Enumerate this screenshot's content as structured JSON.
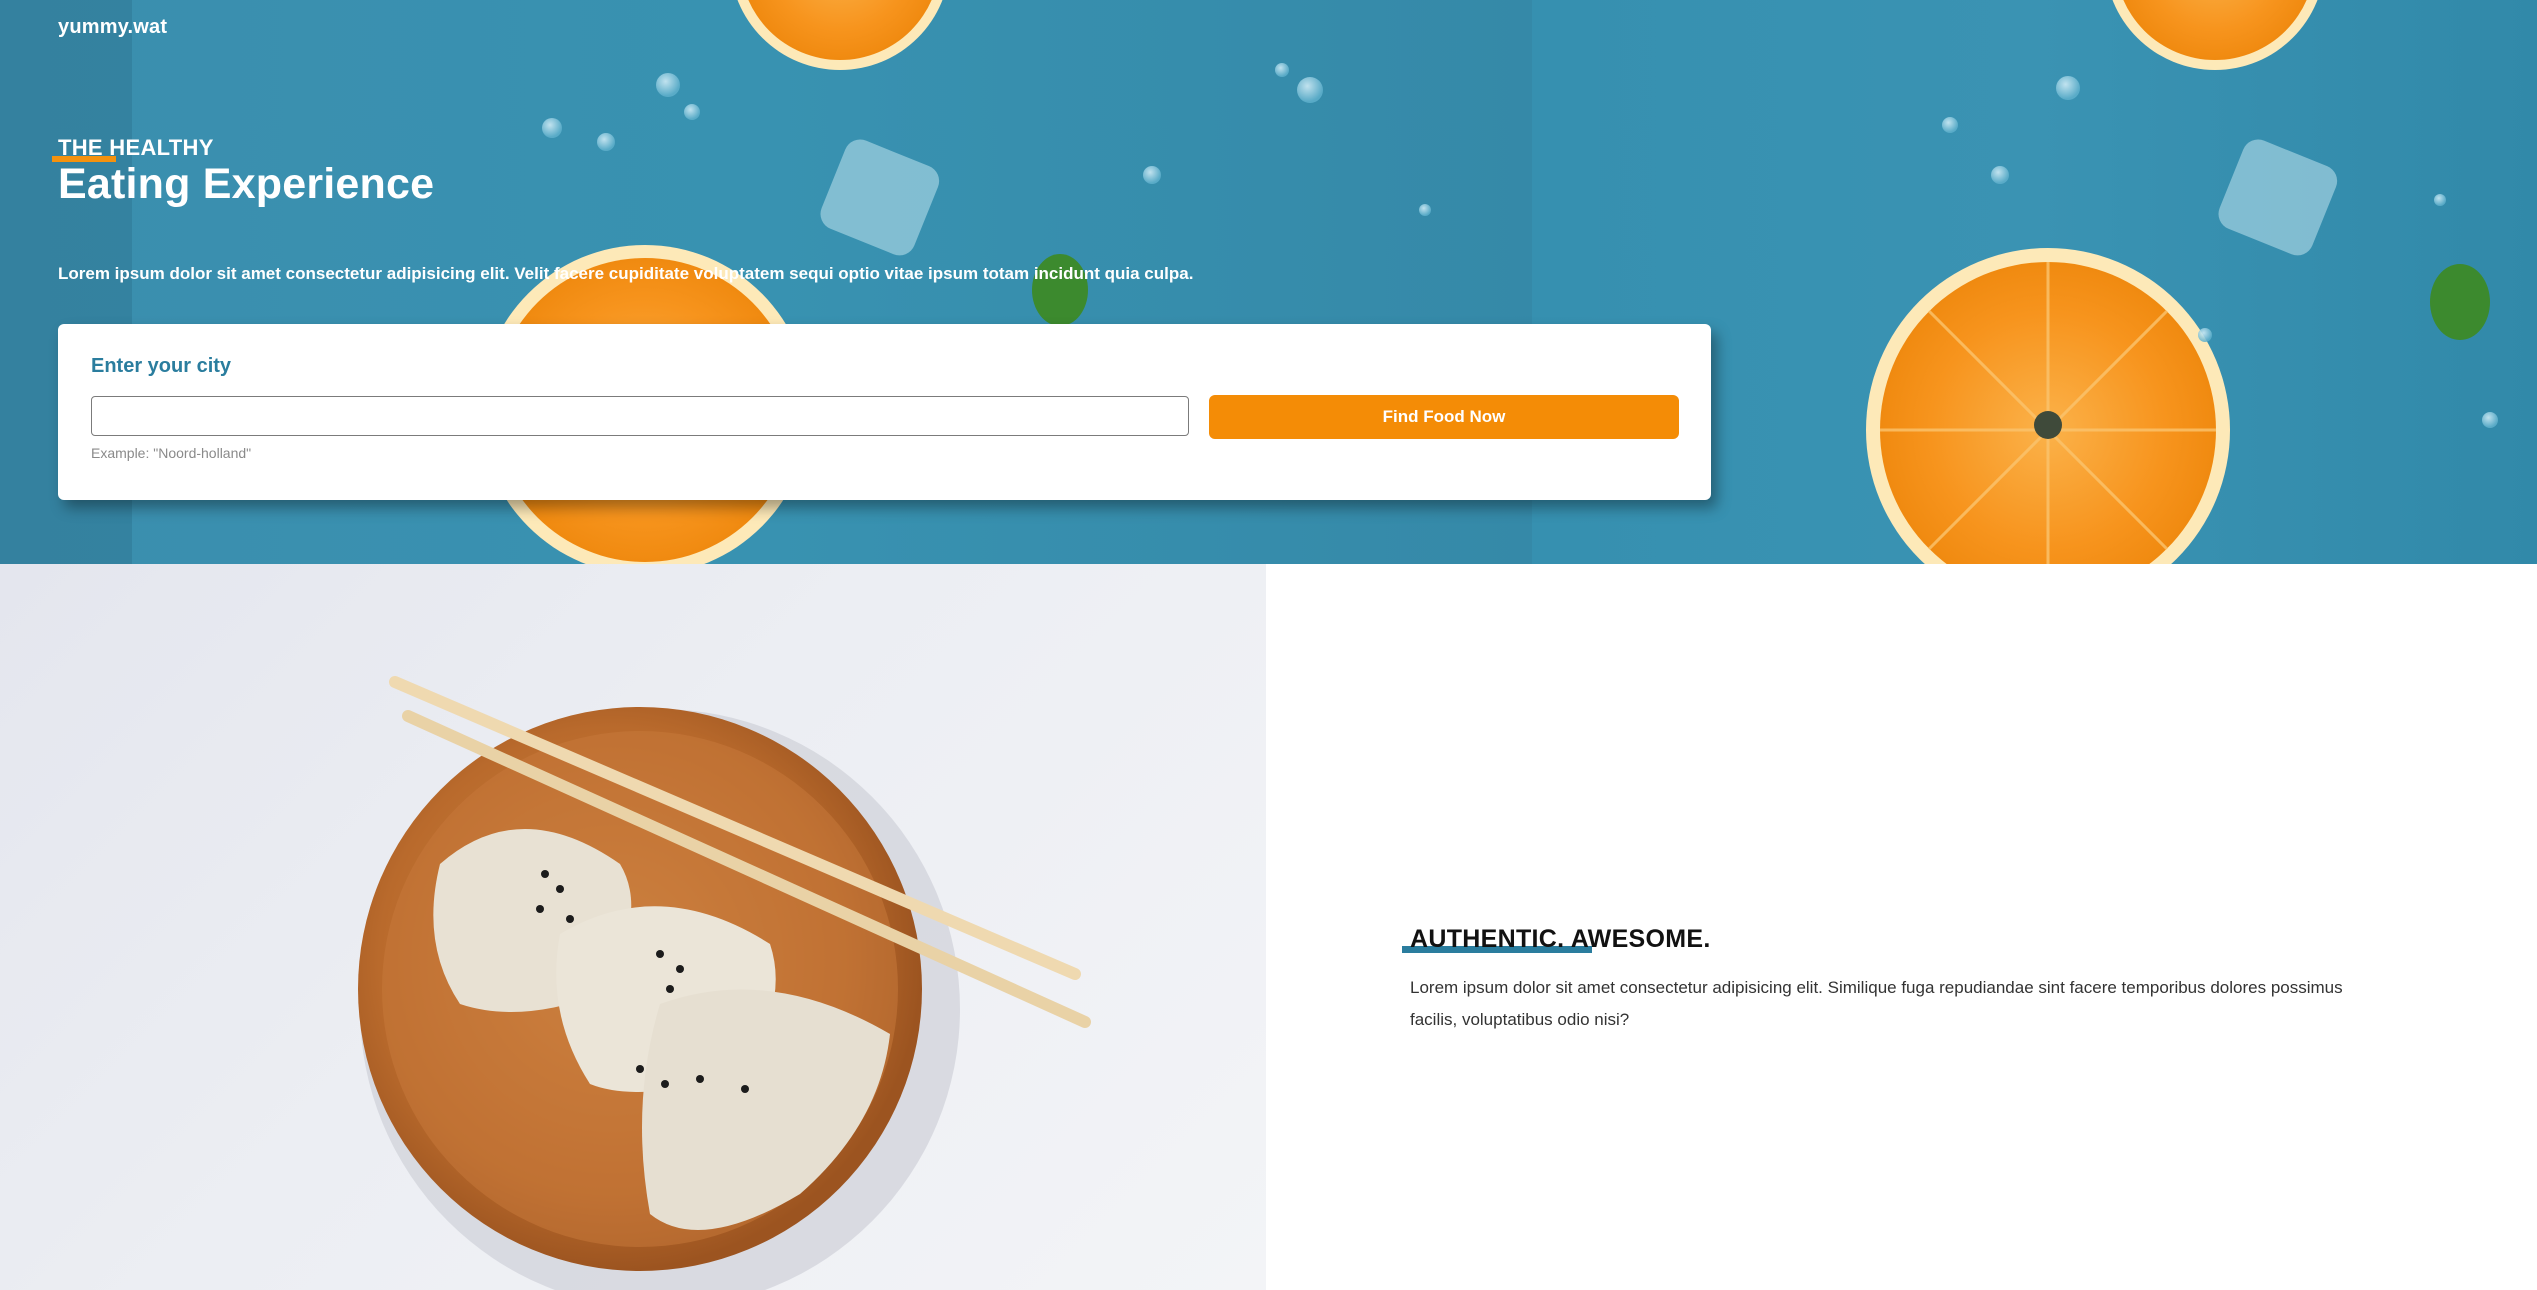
{
  "brand": {
    "logo_text": "yummy.wat"
  },
  "hero": {
    "kicker": "THE HEALTHY",
    "headline": "Eating Experience",
    "description": "Lorem ipsum dolor sit amet consectetur adipisicing elit. Velit facere cupiditate voluptatem sequi optio vitae ipsum totam incidunt quia culpa."
  },
  "search": {
    "label": "Enter your city",
    "input_value": "",
    "input_placeholder": "",
    "hint": "Example: \"Noord-holland\"",
    "button_label": "Find Food Now"
  },
  "feature": {
    "title": "AUTHENTIC. AWESOME.",
    "text": "Lorem ipsum dolor sit amet consectetur adipisicing elit. Similique fuga repudiandae sint facere temporibus dolores possimus facilis, voluptatibus odio nisi?"
  },
  "colors": {
    "accent_orange": "#f48c06",
    "brand_teal": "#2a7d9e",
    "hero_background": "#3a8fae"
  },
  "images": {
    "hero": "oranges-on-water-photo",
    "feature": "dumplings-plate-photo"
  }
}
